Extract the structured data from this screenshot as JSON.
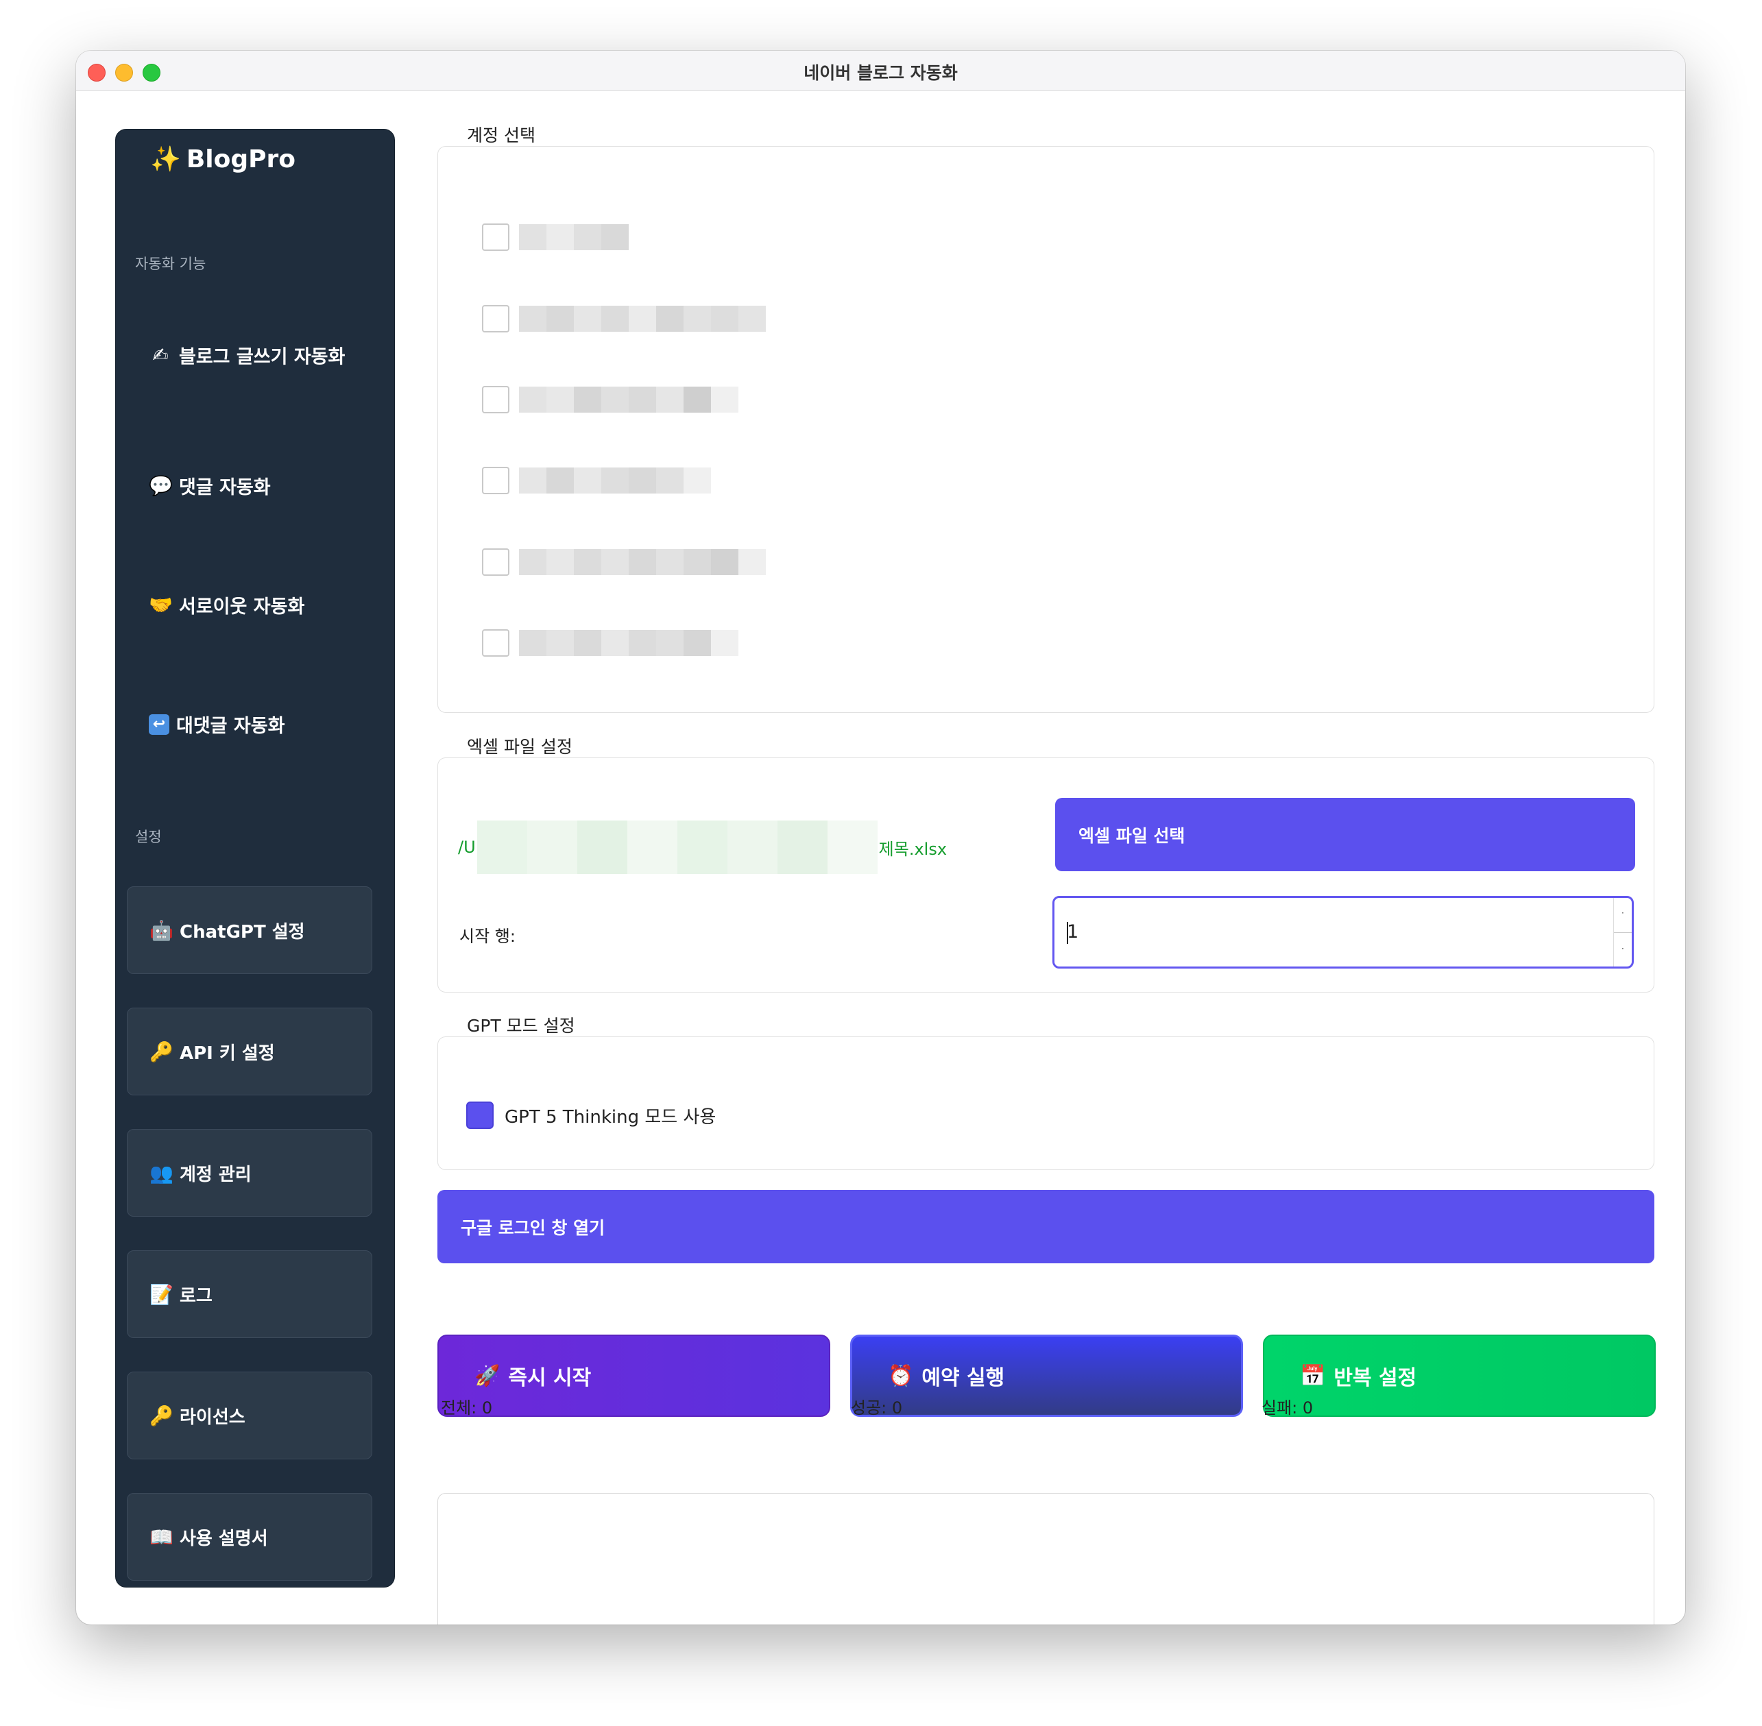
{
  "window": {
    "title": "네이버 블로그 자동화"
  },
  "sidebar": {
    "brand": "BlogPro",
    "section_automation": "자동화 기능",
    "nav": [
      {
        "icon": "✍",
        "label": "블로그 글쓰기 자동화"
      },
      {
        "icon": "💬",
        "label": "댓글 자동화"
      },
      {
        "icon": "🤝",
        "label": "서로이웃 자동화"
      },
      {
        "icon": "↩",
        "label": "대댓글 자동화"
      }
    ],
    "section_settings": "설정",
    "buttons": [
      {
        "icon": "🤖",
        "label": "ChatGPT 설정"
      },
      {
        "icon": "🔑",
        "label": "API 키 설정"
      },
      {
        "icon": "👥",
        "label": "계정 관리"
      },
      {
        "icon": "📝",
        "label": "로그"
      },
      {
        "icon": "🔑",
        "label": "라이선스"
      },
      {
        "icon": "📖",
        "label": "사용 설명서"
      }
    ]
  },
  "account": {
    "label": "계정 선택"
  },
  "excel": {
    "label": "엑셀 파일 설정",
    "path_prefix": "/U",
    "path_suffix": "제목.xlsx",
    "select_button": "엑셀 파일 선택",
    "start_row_label": "시작 행:",
    "start_row_value": "1"
  },
  "gpt": {
    "label": "GPT 모드 설정",
    "thinking_label": "GPT 5 Thinking 모드 사용",
    "thinking_checked": true
  },
  "google_login_button": "구글 로그인 창 열기",
  "actions": {
    "start_now": {
      "icon": "🚀",
      "label": "즉시 시작"
    },
    "schedule": {
      "icon": "⏰",
      "label": "예약 실행"
    },
    "repeat": {
      "icon": "📅",
      "label": "반복 설정"
    }
  },
  "stats": {
    "total": "전체: 0",
    "success": "성공: 0",
    "fail": "실패: 0"
  },
  "colors": {
    "accent": "#5b50ee",
    "sidebar_bg": "#1f2d3d",
    "success_green": "#00d46a",
    "path_green": "#169d2e"
  }
}
